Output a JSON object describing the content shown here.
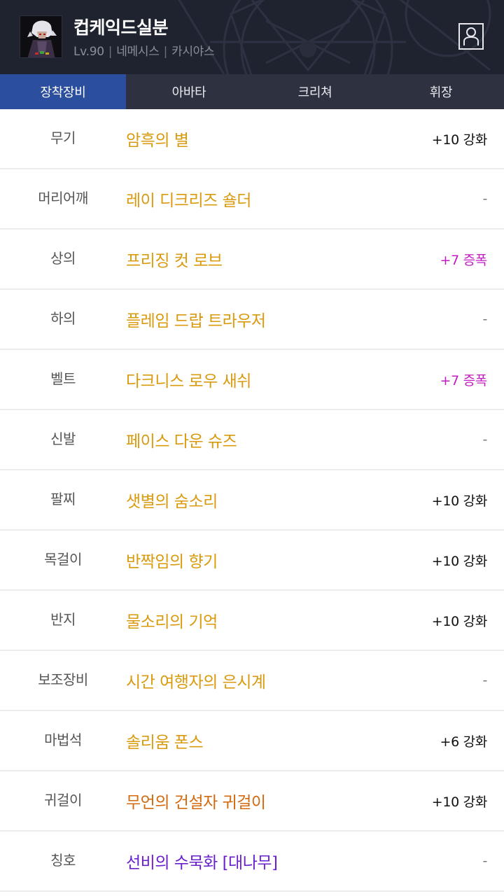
{
  "character": {
    "name": "컵케익드실분",
    "level": "Lv.90",
    "job": "네메시스",
    "server": "카시야스"
  },
  "colors": {
    "header_bg": "#1f2330",
    "tab_bar_bg": "#2e3240",
    "tab_active_bg": "#2b4f9e",
    "epic": "#d99a0e",
    "legendary": "#d4680c",
    "unique": "#6a1fcf",
    "amplify": "#c21cc2"
  },
  "tabs": [
    {
      "label": "장착장비",
      "active": true
    },
    {
      "label": "아바타",
      "active": false
    },
    {
      "label": "크리쳐",
      "active": false
    },
    {
      "label": "휘장",
      "active": false
    }
  ],
  "equipment": [
    {
      "slot": "무기",
      "name": "암흑의 별",
      "upgrade": "+10 강화",
      "rarity": "epic",
      "kind": "reinforce"
    },
    {
      "slot": "머리어깨",
      "name": "레이 디크리즈 숄더",
      "upgrade": "-",
      "rarity": "epic",
      "kind": "none"
    },
    {
      "slot": "상의",
      "name": "프리징 컷 로브",
      "upgrade": "+7 증폭",
      "rarity": "epic",
      "kind": "amp"
    },
    {
      "slot": "하의",
      "name": "플레임 드랍 트라우저",
      "upgrade": "-",
      "rarity": "epic",
      "kind": "none"
    },
    {
      "slot": "벨트",
      "name": "다크니스 로우 새쉬",
      "upgrade": "+7 증폭",
      "rarity": "epic",
      "kind": "amp"
    },
    {
      "slot": "신발",
      "name": "페이스 다운 슈즈",
      "upgrade": "-",
      "rarity": "epic",
      "kind": "none"
    },
    {
      "slot": "팔찌",
      "name": "샛별의 숨소리",
      "upgrade": "+10 강화",
      "rarity": "epic",
      "kind": "reinforce"
    },
    {
      "slot": "목걸이",
      "name": "반짝임의 향기",
      "upgrade": "+10 강화",
      "rarity": "epic",
      "kind": "reinforce"
    },
    {
      "slot": "반지",
      "name": "물소리의 기억",
      "upgrade": "+10 강화",
      "rarity": "epic",
      "kind": "reinforce"
    },
    {
      "slot": "보조장비",
      "name": "시간 여행자의 은시계",
      "upgrade": "-",
      "rarity": "epic",
      "kind": "none"
    },
    {
      "slot": "마법석",
      "name": "솔리움 폰스",
      "upgrade": "+6 강화",
      "rarity": "epic",
      "kind": "reinforce"
    },
    {
      "slot": "귀걸이",
      "name": "무언의 건설자 귀걸이",
      "upgrade": "+10 강화",
      "rarity": "legendary",
      "kind": "reinforce"
    },
    {
      "slot": "칭호",
      "name": "선비의 수묵화 [대나무]",
      "upgrade": "-",
      "rarity": "unique",
      "kind": "none"
    }
  ]
}
